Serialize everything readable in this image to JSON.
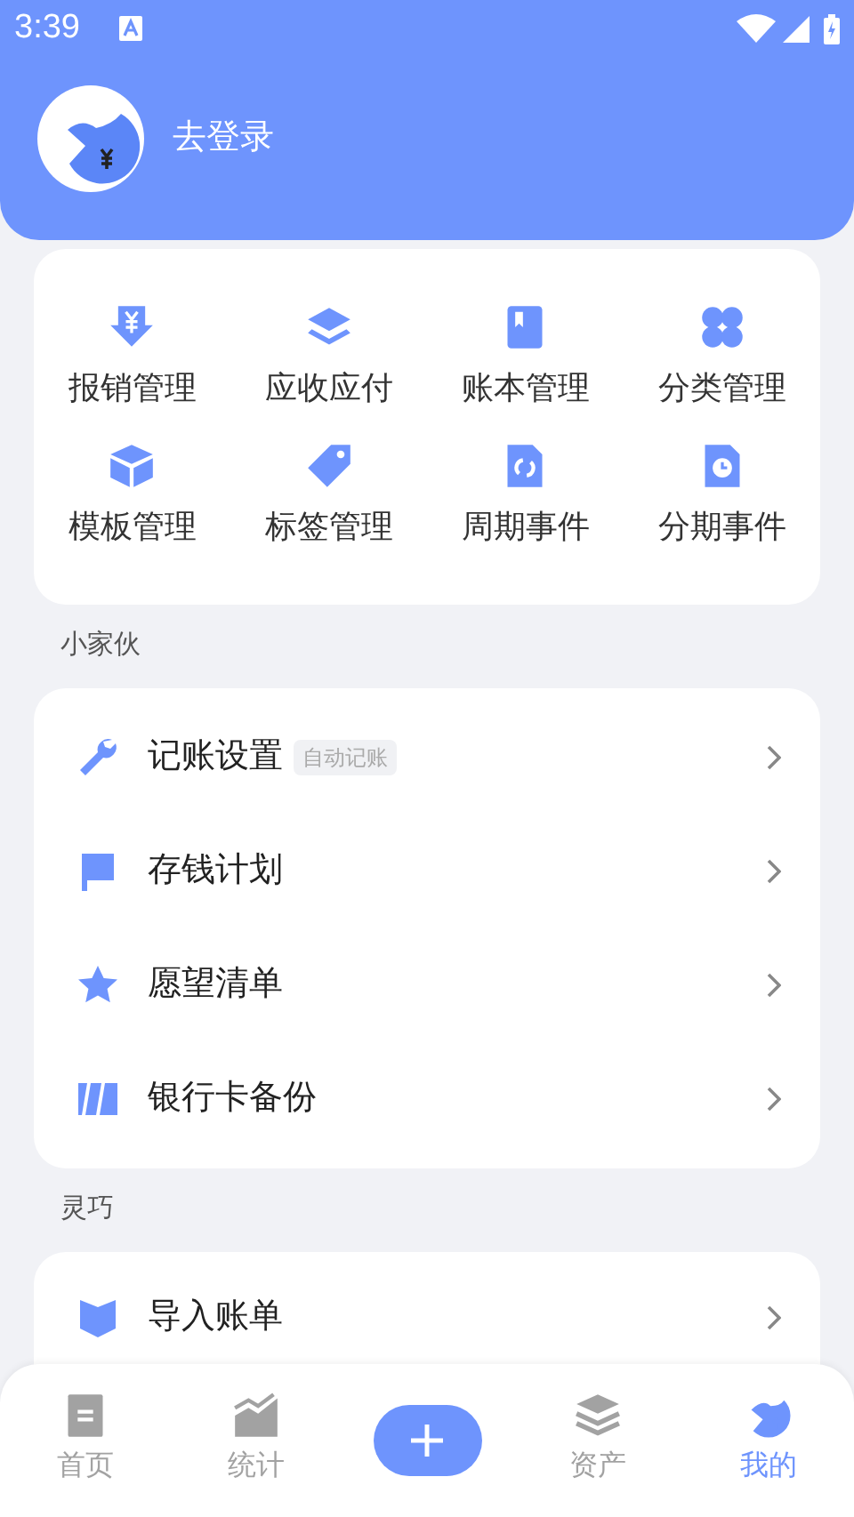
{
  "status_bar": {
    "time": "3:39"
  },
  "header": {
    "login_label": "去登录"
  },
  "tools": [
    {
      "label": "报销管理"
    },
    {
      "label": "应收应付"
    },
    {
      "label": "账本管理"
    },
    {
      "label": "分类管理"
    },
    {
      "label": "模板管理"
    },
    {
      "label": "标签管理"
    },
    {
      "label": "周期事件"
    },
    {
      "label": "分期事件"
    }
  ],
  "sections": [
    {
      "title": "小家伙",
      "items": [
        {
          "label": "记账设置",
          "badge": "自动记账"
        },
        {
          "label": "存钱计划"
        },
        {
          "label": "愿望清单"
        },
        {
          "label": "银行卡备份"
        }
      ]
    },
    {
      "title": "灵巧",
      "items": [
        {
          "label": "导入账单"
        }
      ]
    }
  ],
  "bottom_nav": [
    {
      "label": "首页",
      "selected": false
    },
    {
      "label": "统计",
      "selected": false
    },
    {
      "kind": "add"
    },
    {
      "label": "资产",
      "selected": false
    },
    {
      "label": "我的",
      "selected": true
    }
  ]
}
